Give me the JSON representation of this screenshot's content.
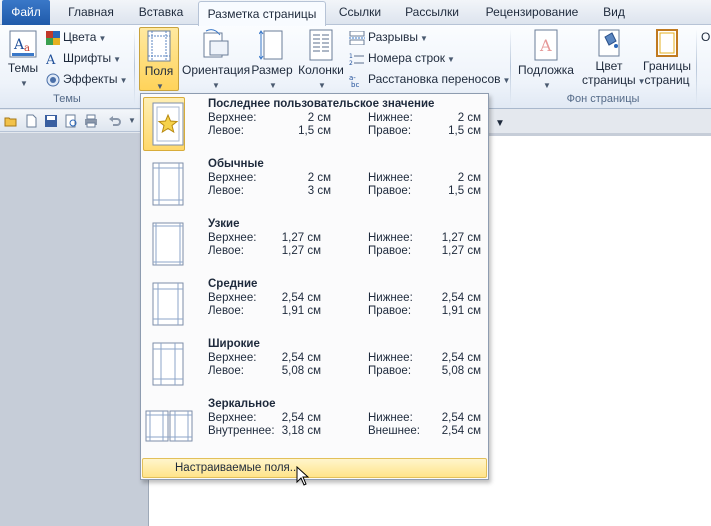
{
  "tabs": [
    {
      "label": "Файл",
      "kind": "file"
    },
    {
      "label": "Главная",
      "kind": "normal"
    },
    {
      "label": "Вставка",
      "kind": "normal"
    },
    {
      "label": "Разметка страницы",
      "kind": "active"
    },
    {
      "label": "Ссылки",
      "kind": "normal"
    },
    {
      "label": "Рассылки",
      "kind": "normal"
    },
    {
      "label": "Рецензирование",
      "kind": "normal"
    },
    {
      "label": "Вид",
      "kind": "normal"
    }
  ],
  "ribbon": {
    "themes_group": {
      "label": "Темы",
      "themes_button": "Темы",
      "colors": "Цвета",
      "fonts": "Шрифты",
      "effects": "Эффекты"
    },
    "page_setup": {
      "margins": "Поля",
      "orientation": "Ориентация",
      "size": "Размер",
      "columns": "Колонки",
      "breaks": "Разрывы",
      "line_numbers": "Номера строк",
      "hyphenation": "Расстановка переносов"
    },
    "page_background": {
      "label": "Фон страницы",
      "watermark": "Подложка",
      "page_color": [
        "Цвет",
        "страницы"
      ],
      "page_borders": [
        "Границы",
        "страниц"
      ],
      "cut_letter": "О"
    }
  },
  "margins_menu": {
    "options": [
      {
        "name": "Последнее пользовательское значение",
        "top_label": "Верхнее:",
        "top": "2 см",
        "bottom_label": "Нижнее:",
        "bottom": "2 см",
        "left_label": "Левое:",
        "left": "1,5 см",
        "right_label": "Правое:",
        "right": "1,5 см",
        "selected": true,
        "icon": "star-page-icon"
      },
      {
        "name": "Обычные",
        "top_label": "Верхнее:",
        "top": "2 см",
        "bottom_label": "Нижнее:",
        "bottom": "2 см",
        "left_label": "Левое:",
        "left": "3 см",
        "right_label": "Правое:",
        "right": "1,5 см",
        "selected": false,
        "icon": "normal-margins-icon"
      },
      {
        "name": "Узкие",
        "top_label": "Верхнее:",
        "top": "1,27 см",
        "bottom_label": "Нижнее:",
        "bottom": "1,27 см",
        "left_label": "Левое:",
        "left": "1,27 см",
        "right_label": "Правое:",
        "right": "1,27 см",
        "selected": false,
        "icon": "narrow-margins-icon"
      },
      {
        "name": "Средние",
        "top_label": "Верхнее:",
        "top": "2,54 см",
        "bottom_label": "Нижнее:",
        "bottom": "2,54 см",
        "left_label": "Левое:",
        "left": "1,91 см",
        "right_label": "Правое:",
        "right": "1,91 см",
        "selected": false,
        "icon": "moderate-margins-icon"
      },
      {
        "name": "Широкие",
        "top_label": "Верхнее:",
        "top": "2,54 см",
        "bottom_label": "Нижнее:",
        "bottom": "2,54 см",
        "left_label": "Левое:",
        "left": "5,08 см",
        "right_label": "Правое:",
        "right": "5,08 см",
        "selected": false,
        "icon": "wide-margins-icon"
      },
      {
        "name": "Зеркальное",
        "top_label": "Верхнее:",
        "top": "2,54 см",
        "bottom_label": "Нижнее:",
        "bottom": "2,54 см",
        "left_label": "Внутреннее:",
        "left": "3,18 см",
        "right_label": "Внешнее:",
        "right": "2,54 см",
        "selected": false,
        "icon": "mirrored-margins-icon"
      }
    ],
    "custom": "Настраиваемые поля..."
  },
  "colors": {
    "file_tab": "#2a66b8",
    "highlight": "#ffd86b",
    "page_accent": "#5b86c0"
  }
}
